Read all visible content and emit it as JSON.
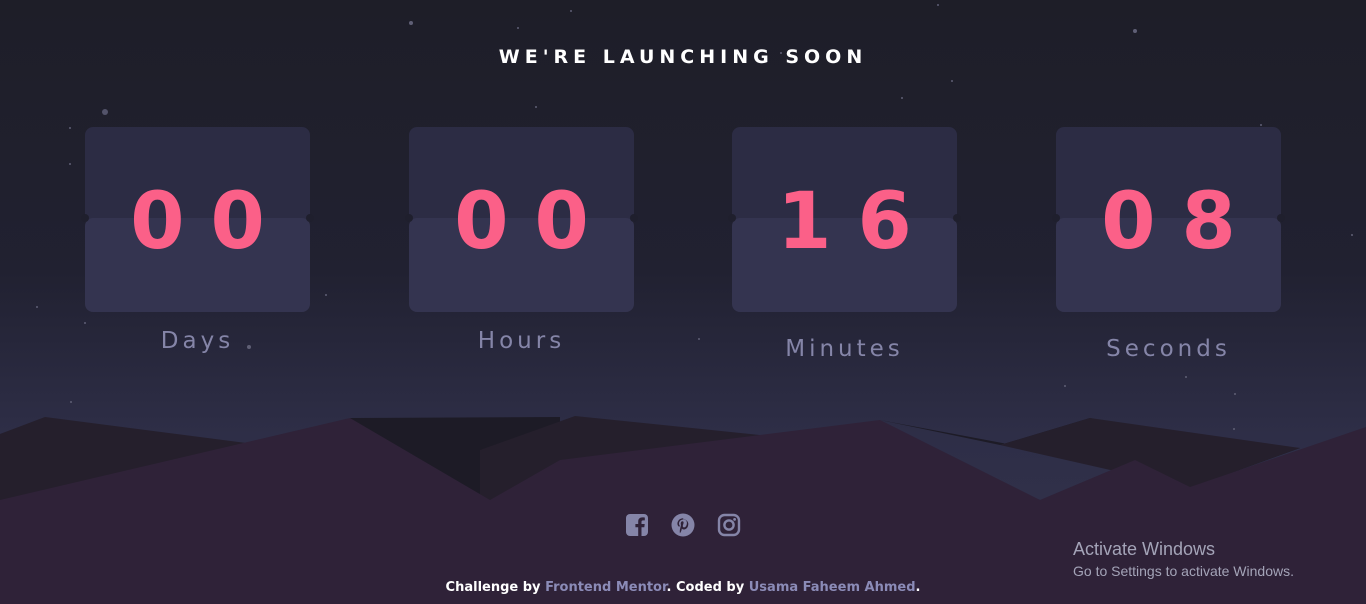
{
  "heading": "WE'RE LAUNCHING SOON",
  "countdown": [
    {
      "value": "00",
      "label": "Days"
    },
    {
      "value": "00",
      "label": "Hours"
    },
    {
      "value": "16",
      "label": "Minutes"
    },
    {
      "value": "08",
      "label": "Seconds"
    }
  ],
  "social": [
    {
      "icon": "facebook-icon"
    },
    {
      "icon": "pinterest-icon"
    },
    {
      "icon": "instagram-icon"
    }
  ],
  "footer": {
    "prefix": "Challenge by ",
    "challenge_link": "Frontend Mentor",
    "middle": ". Coded by ",
    "author_link": "Usama Faheem Ahmed",
    "suffix": "."
  },
  "windows_watermark": {
    "title": "Activate Windows",
    "subtitle": "Go to Settings to activate Windows."
  },
  "colors": {
    "accent": "#fb6088",
    "card_top": "#2c2c44",
    "card_bottom": "#343450",
    "label": "#8585a8",
    "footer_link": "#8b8bb7",
    "hill_dark": "#251f2c",
    "hill_front": "#2f2238"
  }
}
